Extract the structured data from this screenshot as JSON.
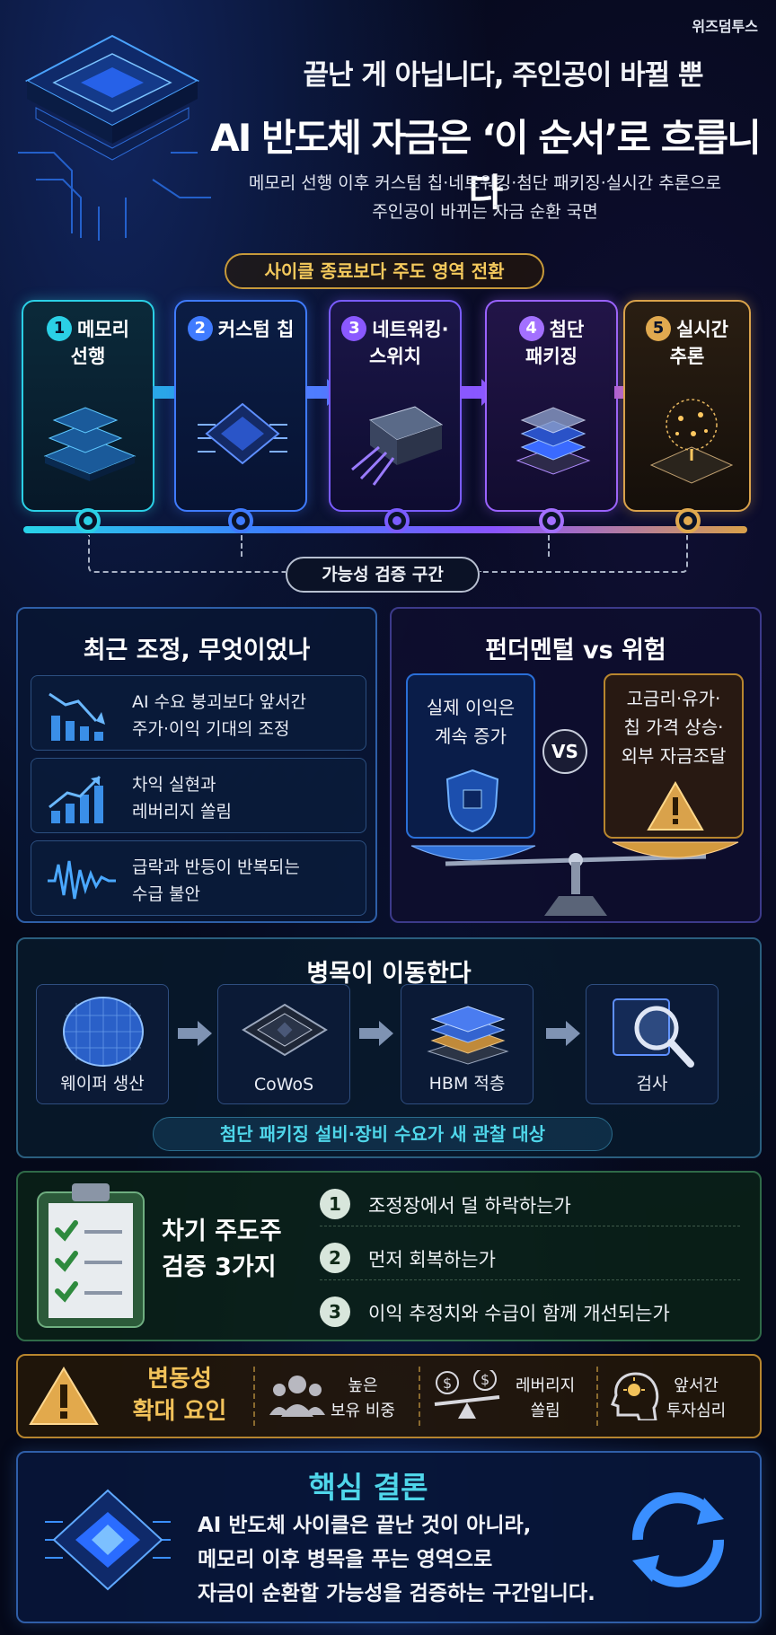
{
  "brand": "위즈덤투스",
  "header": {
    "line1": "끝난 게 아닙니다, 주인공이 바뀔 뿐",
    "line2": "AI 반도체 자금은 ‘이 순서’로 흐릅니다",
    "line3a": "메모리 선행 이후 커스텀 칩·네트워킹·첨단 패키징·실시간 추론으로",
    "line3b": "주인공이 바뀌는 자금 순환 국면"
  },
  "cycle": {
    "badge": "사이클 종료보다 주도 영역 전환",
    "stages": [
      {
        "num": "1",
        "line1": "메모리",
        "line2": "선행"
      },
      {
        "num": "2",
        "line1": "커스텀 칩",
        "line2": ""
      },
      {
        "num": "3",
        "line1": "네트워킹·",
        "line2": "스위치"
      },
      {
        "num": "4",
        "line1": "첨단",
        "line2": "패키징"
      },
      {
        "num": "5",
        "line1": "실시간",
        "line2": "추론"
      }
    ],
    "verification_label": "가능성 검증 구간"
  },
  "recent": {
    "title": "최근 조정, 무엇이었나",
    "items": [
      {
        "line1": "AI 수요 붕괴보다 앞서간",
        "line2": "주가·이익 기대의 조정"
      },
      {
        "line1": "차익 실현과",
        "line2": "레버리지 쏠림"
      },
      {
        "line1": "급락과 반등이 반복되는",
        "line2": "수급 불안"
      }
    ]
  },
  "versus": {
    "title": "펀더멘털 vs 위험",
    "left_line1": "실제 이익은",
    "left_line2": "계속 증가",
    "vs": "VS",
    "right_line1": "고금리·유가·",
    "right_line2": "칩 가격 상승·",
    "right_line3": "외부 자금조달"
  },
  "bottleneck": {
    "title": "병목이 이동한다",
    "steps": [
      "웨이퍼 생산",
      "CoWoS",
      "HBM 적층",
      "검사"
    ],
    "note": "첨단 패키징 설비·장비 수요가 새 관찰 대상"
  },
  "checklist": {
    "title_line1": "차기 주도주",
    "title_line2": "검증 3가지",
    "items": [
      {
        "num": "1",
        "text": "조정장에서 덜 하락하는가"
      },
      {
        "num": "2",
        "text": "먼저 회복하는가"
      },
      {
        "num": "3",
        "text": "이익 추정치와 수급이 함께 개선되는가"
      }
    ]
  },
  "volatility": {
    "title_line1": "변동성",
    "title_line2": "확대 요인",
    "factors": [
      {
        "line1": "높은",
        "line2": "보유 비중"
      },
      {
        "line1": "레버리지",
        "line2": "쏠림"
      },
      {
        "line1": "앞서간",
        "line2": "투자심리"
      }
    ]
  },
  "conclusion": {
    "title": "핵심 결론",
    "line1": "AI 반도체 사이클은 끝난 것이 아니라,",
    "line2": "메모리 이후 병목을 푸는 영역으로",
    "line3": "자금이 순환할 가능성을 검증하는 구간입니다."
  },
  "colors": {
    "cyan": "#2bd0e6",
    "blue": "#3f7bff",
    "purple": "#8a58ff",
    "gold": "#d9a24b",
    "green_panel": "#2f6a48"
  }
}
